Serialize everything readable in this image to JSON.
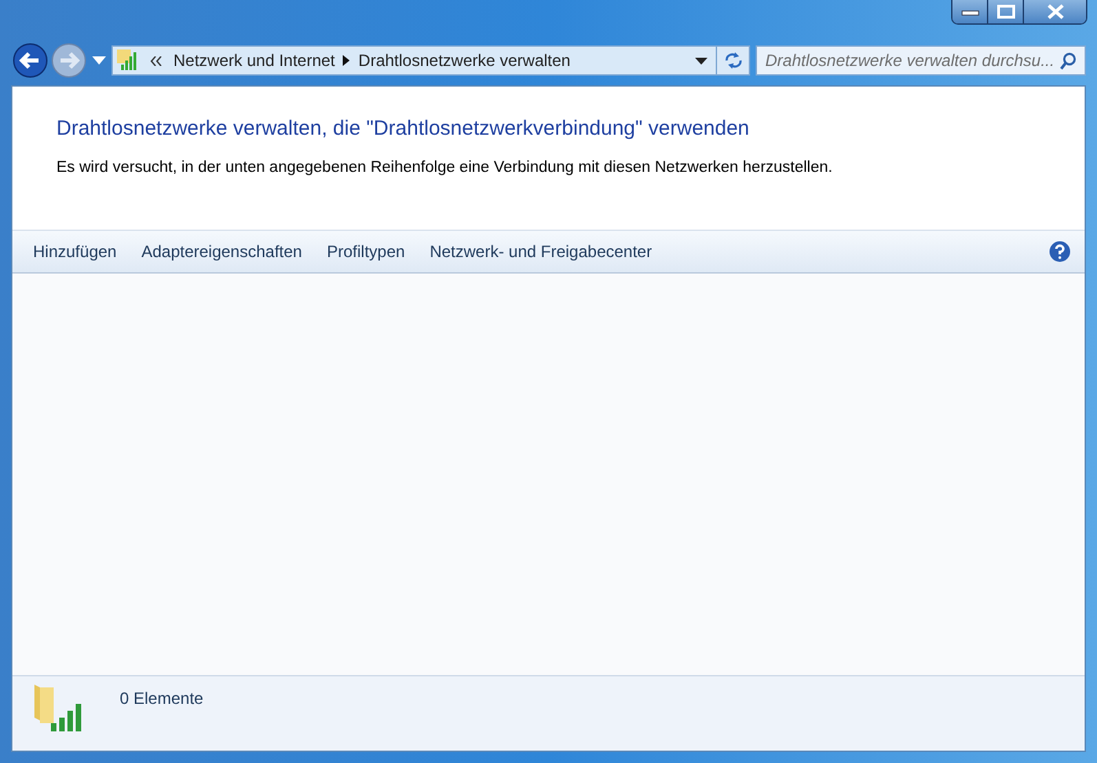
{
  "address_bar": {
    "crumbs": [
      "Netzwerk und Internet",
      "Drahtlosnetzwerke verwalten"
    ]
  },
  "search": {
    "placeholder": "Drahtlosnetzwerke verwalten durchsu..."
  },
  "header": {
    "title": "Drahtlosnetzwerke verwalten, die \"Drahtlosnetzwerkverbindung\" verwenden",
    "description": "Es wird versucht, in der unten angegebenen Reihenfolge eine Verbindung mit diesen Netzwerken herzustellen."
  },
  "toolbar": {
    "items": [
      "Hinzufügen",
      "Adaptereigenschaften",
      "Profiltypen",
      "Netzwerk- und Freigabecenter"
    ]
  },
  "details_pane": {
    "count": "0 Elemente"
  }
}
